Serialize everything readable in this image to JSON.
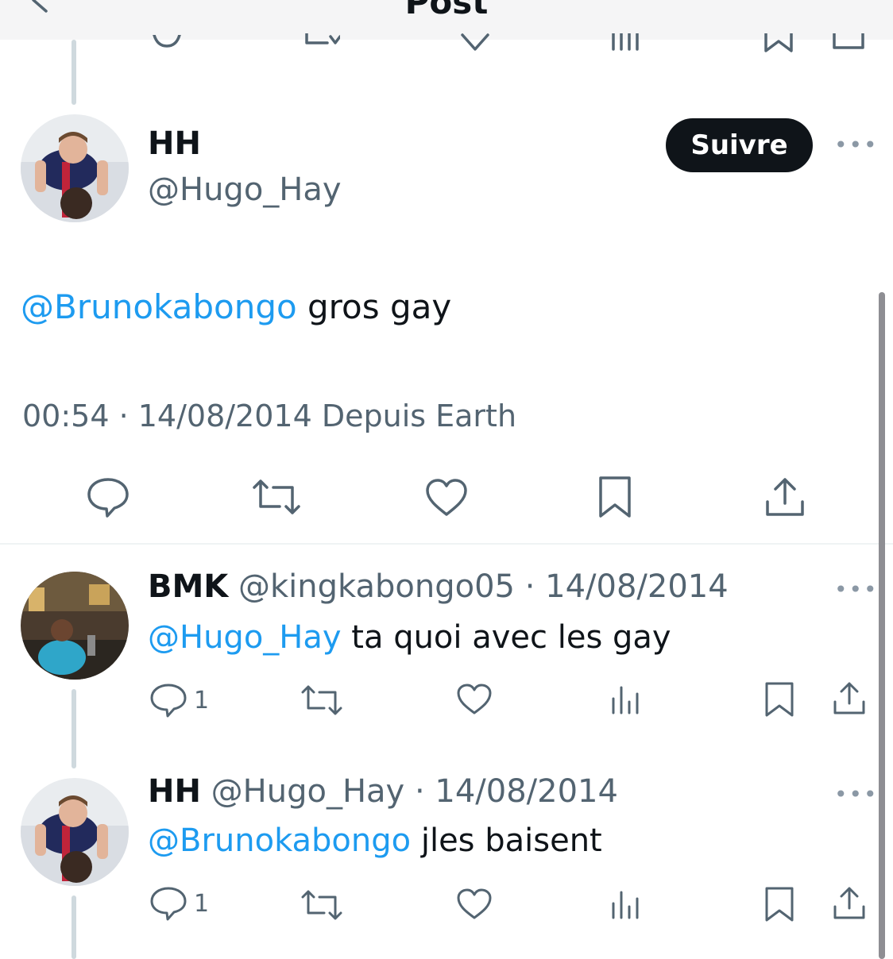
{
  "header": {
    "title": "Post"
  },
  "main_tweet": {
    "name": "HH",
    "handle": "@Hugo_Hay",
    "follow_label": "Suivre",
    "more_label": "•••",
    "mention": "@Brunokabongo",
    "text": " gros gay",
    "timestamp": "00:54 · 14/08/2014 Depuis Earth"
  },
  "replies": [
    {
      "name": "BMK",
      "handle": "@kingkabongo05",
      "date": " · 14/08/2014",
      "mention": "@Hugo_Hay",
      "text": " ta quoi avec les gay",
      "reply_count": "1",
      "more_label": "•••"
    },
    {
      "name": "HH",
      "handle": "@Hugo_Hay",
      "date": " · 14/08/2014",
      "mention": "@Brunokabongo",
      "text": " jles baisent",
      "reply_count": "1",
      "more_label": "•••"
    }
  ],
  "colors": {
    "accent": "#1d9bf0",
    "text": "#0f1419",
    "muted": "#536471",
    "button": "#0f1419"
  }
}
